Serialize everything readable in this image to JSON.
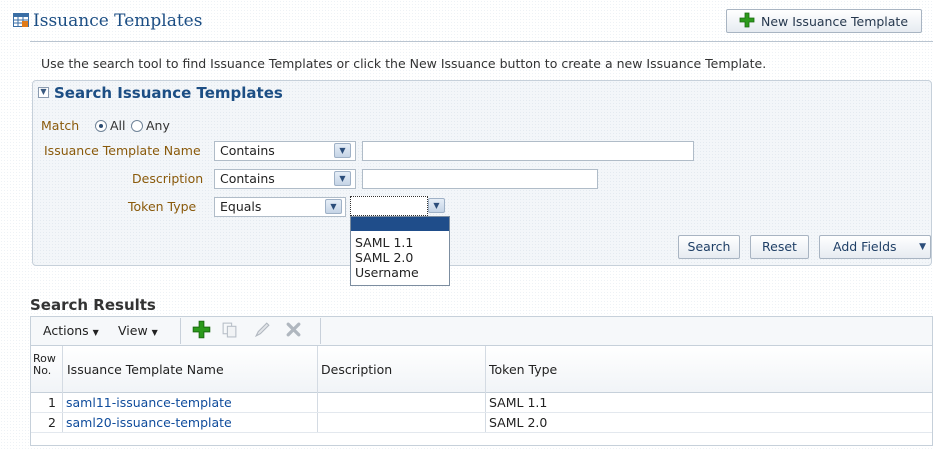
{
  "header": {
    "title": "Issuance Templates",
    "new_button_label": "New Issuance Template"
  },
  "instructions": "Use the search tool to find Issuance Templates or click the New Issuance button to create a new Issuance Template.",
  "search": {
    "title": "Search Issuance Templates",
    "match_label": "Match",
    "match_all": "All",
    "match_any": "Any",
    "fields": [
      {
        "label": "Issuance Template Name",
        "operator": "Contains",
        "value": ""
      },
      {
        "label": "Description",
        "operator": "Contains",
        "value": ""
      },
      {
        "label": "Token Type",
        "operator": "Equals",
        "value": ""
      }
    ],
    "token_type_options": [
      "",
      "SAML 1.1",
      "SAML 2.0",
      "Username"
    ],
    "buttons": {
      "search": "Search",
      "reset": "Reset",
      "add_fields": "Add Fields"
    }
  },
  "results": {
    "title": "Search Results",
    "actions_label": "Actions",
    "view_label": "View",
    "columns": [
      "Row No.",
      "Issuance Template Name",
      "Description",
      "Token Type"
    ],
    "row_no_line1": "Row",
    "row_no_line2": "No.",
    "rows": [
      {
        "no": "1",
        "name": "saml11-issuance-template",
        "description": "",
        "token_type": "SAML 1.1"
      },
      {
        "no": "2",
        "name": "saml20-issuance-template",
        "description": "",
        "token_type": "SAML 2.0"
      }
    ]
  },
  "colors": {
    "title_blue": "#1c4e84",
    "label_brown": "#8a5a0b",
    "link_blue": "#0f4c9c",
    "selected_option": "#1f4d8a",
    "add_green": "#2c9a1c"
  }
}
